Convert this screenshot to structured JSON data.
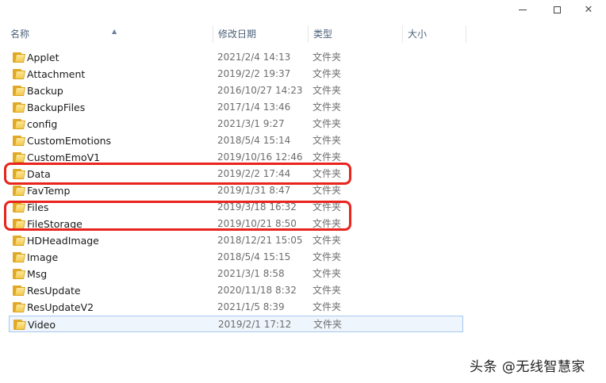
{
  "window": {
    "minimize_label": "",
    "maximize_label": "",
    "close_label": "✕"
  },
  "columns": {
    "name": "名称",
    "date": "修改日期",
    "type": "类型",
    "size": "大小"
  },
  "items": [
    {
      "name": "Applet",
      "date": "2021/2/4 14:13",
      "type": "文件夹"
    },
    {
      "name": "Attachment",
      "date": "2019/2/2 19:37",
      "type": "文件夹"
    },
    {
      "name": "Backup",
      "date": "2016/10/27 14:23",
      "type": "文件夹"
    },
    {
      "name": "BackupFiles",
      "date": "2017/1/4 13:46",
      "type": "文件夹"
    },
    {
      "name": "config",
      "date": "2021/3/1 9:27",
      "type": "文件夹"
    },
    {
      "name": "CustomEmotions",
      "date": "2018/5/4 15:14",
      "type": "文件夹"
    },
    {
      "name": "CustomEmoV1",
      "date": "2019/10/16 12:46",
      "type": "文件夹"
    },
    {
      "name": "Data",
      "date": "2019/2/2 17:44",
      "type": "文件夹"
    },
    {
      "name": "FavTemp",
      "date": "2019/1/31 8:47",
      "type": "文件夹"
    },
    {
      "name": "Files",
      "date": "2019/3/18 16:32",
      "type": "文件夹"
    },
    {
      "name": "FileStorage",
      "date": "2019/10/21 8:50",
      "type": "文件夹"
    },
    {
      "name": "HDHeadImage",
      "date": "2018/12/21 15:05",
      "type": "文件夹"
    },
    {
      "name": "Image",
      "date": "2018/5/4 15:15",
      "type": "文件夹"
    },
    {
      "name": "Msg",
      "date": "2021/3/1 8:58",
      "type": "文件夹"
    },
    {
      "name": "ResUpdate",
      "date": "2020/11/18 8:32",
      "type": "文件夹"
    },
    {
      "name": "ResUpdateV2",
      "date": "2021/1/5 8:39",
      "type": "文件夹"
    },
    {
      "name": "Video",
      "date": "2019/2/1 17:12",
      "type": "文件夹",
      "selected": true
    }
  ],
  "icons": {
    "folder": "folder-icon",
    "sort": "sort-up-arrow-icon"
  },
  "colors": {
    "highlight": "#e8241c",
    "selection_bg": "#eef5fd",
    "selection_border": "#a7c8ec",
    "folder": "#f2c94c"
  },
  "watermark": "头条 @无线智慧家"
}
